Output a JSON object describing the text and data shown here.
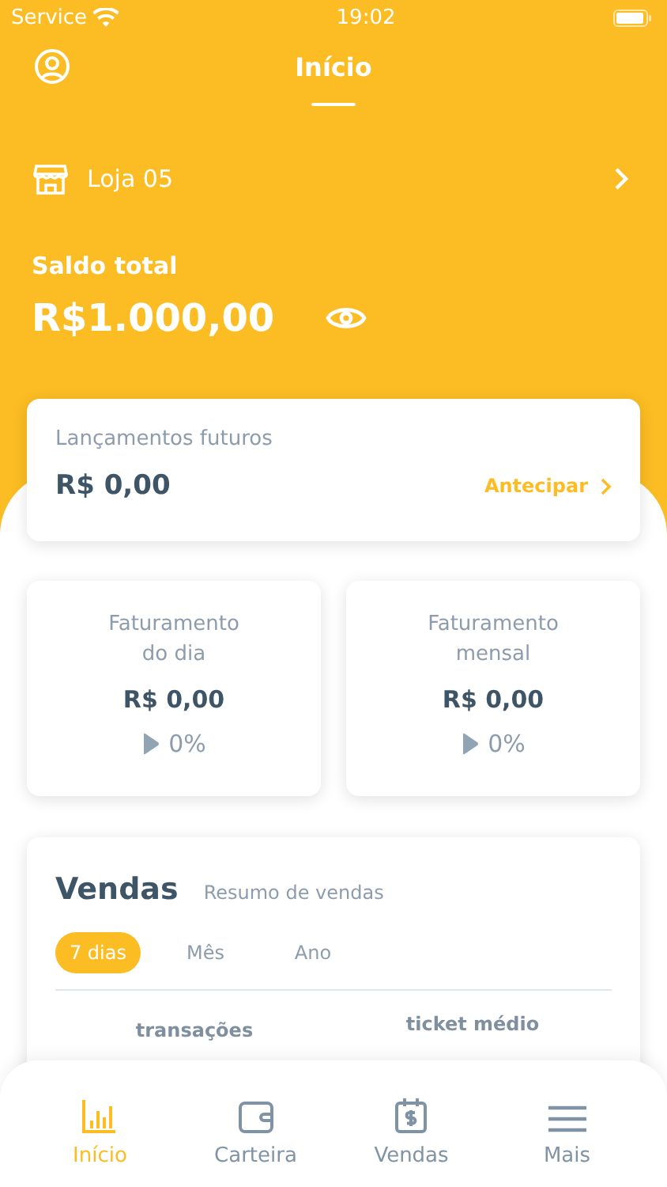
{
  "status_bar": {
    "carrier": "Service",
    "time": "19:02"
  },
  "header": {
    "title": "Início"
  },
  "store": {
    "name": "Loja 05"
  },
  "balance": {
    "label": "Saldo total",
    "amount": "R$1.000,00"
  },
  "future_entries": {
    "label": "Lançamentos futuros",
    "amount": "R$ 0,00",
    "action": "Antecipar"
  },
  "stats": [
    {
      "title": "Faturamento do dia",
      "value": "R$ 0,00",
      "change": "0%"
    },
    {
      "title": "Faturamento mensal",
      "value": "R$ 0,00",
      "change": "0%"
    }
  ],
  "sales": {
    "title": "Vendas",
    "subtitle": "Resumo de vendas",
    "periods": [
      {
        "label": "7 dias",
        "selected": true
      },
      {
        "label": "Mês",
        "selected": false
      },
      {
        "label": "Ano",
        "selected": false
      }
    ],
    "metrics": [
      {
        "label": "transações"
      },
      {
        "label": "ticket médio"
      }
    ]
  },
  "tab_bar": [
    {
      "label": "Início",
      "selected": true
    },
    {
      "label": "Carteira",
      "selected": false
    },
    {
      "label": "Vendas",
      "selected": false
    },
    {
      "label": "Mais",
      "selected": false
    }
  ]
}
